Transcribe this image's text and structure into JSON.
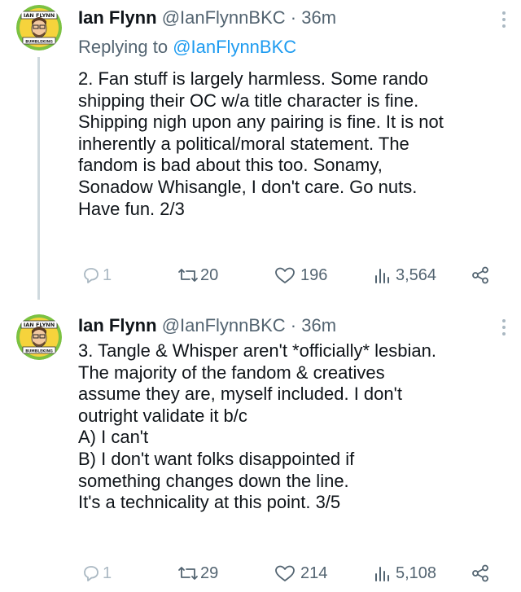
{
  "tweets": [
    {
      "avatar_icon": "ian-flynn-avatar-icon",
      "name": "Ian Flynn",
      "handle": "@IanFlynnBKC",
      "dot": "·",
      "time": "36m",
      "replying_prefix": "Replying to",
      "replying_mention": "@IanFlynnBKC",
      "lines": [
        "2. Fan stuff is largely harmless. Some rando",
        "shipping their OC w/a title character is fine.",
        "Shipping nigh upon any pairing is fine. It is not",
        "inherently a political/moral statement. The",
        "fandom is bad about this too.  Sonamy,",
        "Sonadow Whisangle, I don't care. Go nuts.",
        "Have fun. 2/3"
      ],
      "replies": "1",
      "retweets": "20",
      "likes": "196",
      "views": "3,564"
    },
    {
      "avatar_icon": "ian-flynn-avatar-icon",
      "name": "Ian Flynn",
      "handle": "@IanFlynnBKC",
      "dot": "·",
      "time": "36m",
      "lines": [
        "3. Tangle & Whisper aren't *officially* lesbian.",
        "The majority of the fandom & creatives",
        "assume they are, myself included. I don't",
        "outright validate it b/c",
        "A) I can't",
        "B) I don't want folks disappointed if",
        "something changes down the line.",
        "It's a technicality at this point. 3/5"
      ],
      "replies": "1",
      "retweets": "29",
      "likes": "214",
      "views": "5,108"
    }
  ],
  "avatar_text": {
    "top": "IAN FLYNN",
    "bottom": "BUMBLEKING"
  },
  "colors": {
    "accent": "#1d9bf0",
    "secondary_text": "#536471",
    "thread_line": "#cfd9de"
  }
}
